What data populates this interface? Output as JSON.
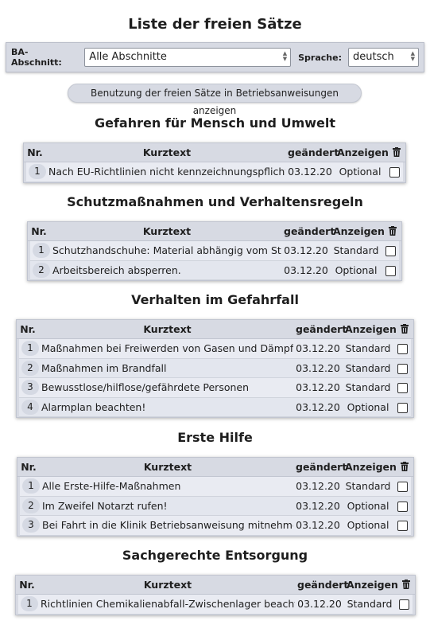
{
  "title": "Liste der freien Sätze",
  "filter": {
    "section_label": "BA-Abschnitt:",
    "section_value": "Alle Abschnitte",
    "language_label": "Sprache:",
    "language_value": "deutsch"
  },
  "usage_button": "Benutzung der freien Sätze in Betriebsanweisungen anzeigen",
  "columns": {
    "nr": "Nr.",
    "text": "Kurztext",
    "changed": "geändert",
    "show": "Anzeigen",
    "delete_icon": "trash-icon"
  },
  "sections": [
    {
      "title": "Gefahren für Mensch und Umwelt",
      "rows": [
        {
          "nr": "1",
          "text": "Nach EU-Richtlinien nicht kennzeichnungspflichtig.",
          "date": "03.12.20",
          "show": "Optional",
          "checked": false
        }
      ]
    },
    {
      "title": "Schutzmaßnahmen und Verhaltensregeln",
      "rows": [
        {
          "nr": "1",
          "text": "Schutzhandschuhe: Material abhängig vom Stoff.",
          "date": "03.12.20",
          "show": "Standard",
          "checked": false
        },
        {
          "nr": "2",
          "text": "Arbeitsbereich absperren.",
          "date": "03.12.20",
          "show": "Optional",
          "checked": false
        }
      ]
    },
    {
      "title": "Verhalten im Gefahrfall",
      "rows": [
        {
          "nr": "1",
          "text": "Maßnahmen bei Freiwerden von Gasen und Dämpfen",
          "date": "03.12.20",
          "show": "Standard",
          "checked": false
        },
        {
          "nr": "2",
          "text": "Maßnahmen im Brandfall",
          "date": "03.12.20",
          "show": "Standard",
          "checked": false
        },
        {
          "nr": "3",
          "text": "Bewusstlose/hilflose/gefährdete Personen",
          "date": "03.12.20",
          "show": "Standard",
          "checked": false
        },
        {
          "nr": "4",
          "text": "Alarmplan beachten!",
          "date": "03.12.20",
          "show": "Optional",
          "checked": false
        }
      ]
    },
    {
      "title": "Erste Hilfe",
      "rows": [
        {
          "nr": "1",
          "text": "Alle Erste-Hilfe-Maßnahmen",
          "date": "03.12.20",
          "show": "Standard",
          "checked": false
        },
        {
          "nr": "2",
          "text": "Im Zweifel Notarzt rufen!",
          "date": "03.12.20",
          "show": "Optional",
          "checked": false
        },
        {
          "nr": "3",
          "text": "Bei Fahrt in die Klinik Betriebsanweisung mitnehmen!",
          "date": "03.12.20",
          "show": "Optional",
          "checked": false
        }
      ]
    },
    {
      "title": "Sachgerechte Entsorgung",
      "rows": [
        {
          "nr": "1",
          "text": "Richtlinien Chemikalienabfall-Zwischenlager beachten.",
          "date": "03.12.20",
          "show": "Standard",
          "checked": false
        }
      ]
    }
  ]
}
